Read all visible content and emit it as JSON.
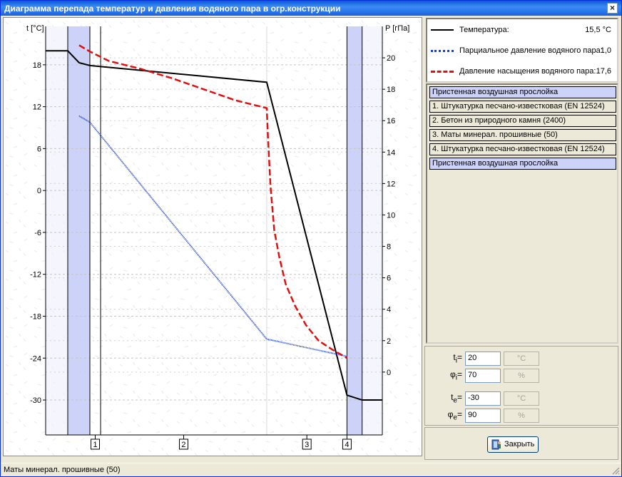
{
  "window": {
    "title": "Диаграмма перепада температур и давления водяного пара в огр.конструкции",
    "close_glyph": "×"
  },
  "chart": {
    "left_axis_label": "t [°C]",
    "right_axis_label": "P [гПа]",
    "section_markers": [
      "1",
      "2",
      "3",
      "4"
    ]
  },
  "chart_data": {
    "type": "line",
    "left_axis": {
      "label": "t [°C]",
      "ticks": [
        18,
        12,
        6,
        0,
        -6,
        -12,
        -18,
        -24,
        -30
      ],
      "range": [
        -35,
        23.5
      ]
    },
    "right_axis": {
      "label": "P [гПа]",
      "ticks": [
        20,
        18,
        16,
        14,
        12,
        10,
        8,
        6,
        4,
        2,
        0
      ],
      "range": [
        -4,
        22
      ]
    },
    "boundaries_x": [
      0,
      35,
      70,
      87,
      350,
      477,
      501,
      533
    ],
    "series": [
      {
        "name": "Температура",
        "axis": "left",
        "color": "#000000",
        "x": [
          0,
          35,
          53,
          70,
          350,
          477,
          501,
          533
        ],
        "y": [
          20,
          20,
          18.3,
          17.9,
          15.5,
          -29.3,
          -30,
          -30
        ]
      },
      {
        "name": "Парциальное давление водяного пара",
        "axis": "right",
        "color": "#1a3fd6",
        "x": [
          53,
          70,
          350,
          477
        ],
        "y": [
          16.3,
          15.9,
          2.1,
          1.0
        ]
      },
      {
        "name": "Давление насыщения водяного пара",
        "axis": "right",
        "color": "#e01010",
        "x": [
          53,
          70,
          100,
          150,
          200,
          250,
          300,
          350,
          352,
          356,
          362,
          370,
          380,
          395,
          412,
          432,
          455,
          477
        ],
        "y": [
          20.8,
          20.4,
          19.8,
          19.3,
          18.7,
          18.0,
          17.3,
          16.8,
          14.9,
          11.8,
          9.0,
          7.3,
          5.6,
          4.2,
          3.0,
          2.0,
          1.4,
          0.9
        ]
      }
    ]
  },
  "legend": {
    "items": [
      {
        "label": "Температура:",
        "value": "15,5 °C",
        "style": "solid",
        "color": "#000000"
      },
      {
        "label": "Парциальное давление водяного пара:",
        "value": "1,0",
        "style": "dotted",
        "color": "#1a3fd6"
      },
      {
        "label": "Давление насыщения водяного пара:",
        "value": "17,6",
        "style": "dashed",
        "color": "#e01010"
      }
    ]
  },
  "layers": [
    {
      "label": "Пристенная воздушная прослойка",
      "kind": "air"
    },
    {
      "label": "1. Штукатурка песчано-известковая (EN 12524)",
      "kind": "layer"
    },
    {
      "label": "2. Бетон из природного камня (2400)",
      "kind": "layer"
    },
    {
      "label": "3. Маты минерал. прошивные (50)",
      "kind": "layer"
    },
    {
      "label": "4. Штукатурка песчано-известковая (EN 12524)",
      "kind": "layer"
    },
    {
      "label": "Пристенная воздушная прослойка",
      "kind": "air"
    }
  ],
  "inputs": {
    "ti": {
      "label": "t",
      "sub": "i",
      "value": "20",
      "unit": "°C"
    },
    "phii": {
      "label": "φ",
      "sub": "i",
      "value": "70",
      "unit": "%"
    },
    "te": {
      "label": "t",
      "sub": "e",
      "value": "-30",
      "unit": "°C"
    },
    "phie": {
      "label": "φ",
      "sub": "e",
      "value": "90",
      "unit": "%"
    }
  },
  "close_button_label": "Закрыть",
  "status_text": "Маты минерал. прошивные (50)",
  "colors": {
    "titlebar": "#0a58d8",
    "air_layer": "#ccd2f8",
    "temp": "#000000",
    "partial": "#1a3fd6",
    "saturation": "#e01010"
  }
}
